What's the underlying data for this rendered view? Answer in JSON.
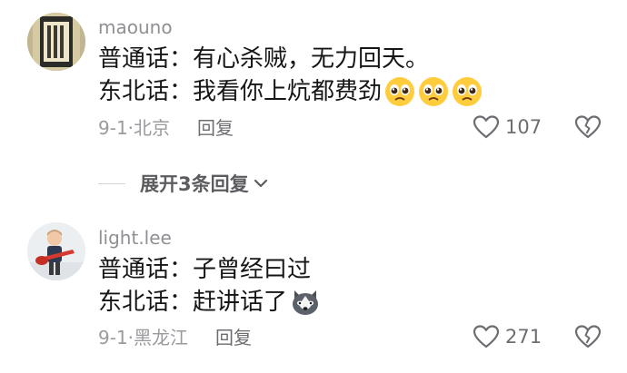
{
  "comments": [
    {
      "username": "maouno",
      "lines": [
        {
          "label": "普通话：",
          "text": "有心杀贼，无力回天。"
        },
        {
          "label": "东北话：",
          "text": "我看你上炕都费劲"
        }
      ],
      "emojis": [
        "pleading-face-emoji",
        "pleading-face-emoji",
        "pleading-face-emoji"
      ],
      "date": "9-1·",
      "location": "北京",
      "reply_label": "回复",
      "likes": "107"
    },
    {
      "username": "light.lee",
      "lines": [
        {
          "label": "普通话：",
          "text": "子曾经曰过"
        },
        {
          "label": "东北话：",
          "text": "赶讲话了"
        }
      ],
      "emojis": [
        "husky-dog-emoji"
      ],
      "date": "9-1·",
      "location": "黑龙江",
      "reply_label": "回复",
      "likes": "271"
    }
  ],
  "expand_replies": {
    "label": "展开3条回复"
  },
  "icons": {
    "like": "heart-outline-icon",
    "dislike": "broken-heart-icon",
    "expand": "chevron-down-icon"
  }
}
